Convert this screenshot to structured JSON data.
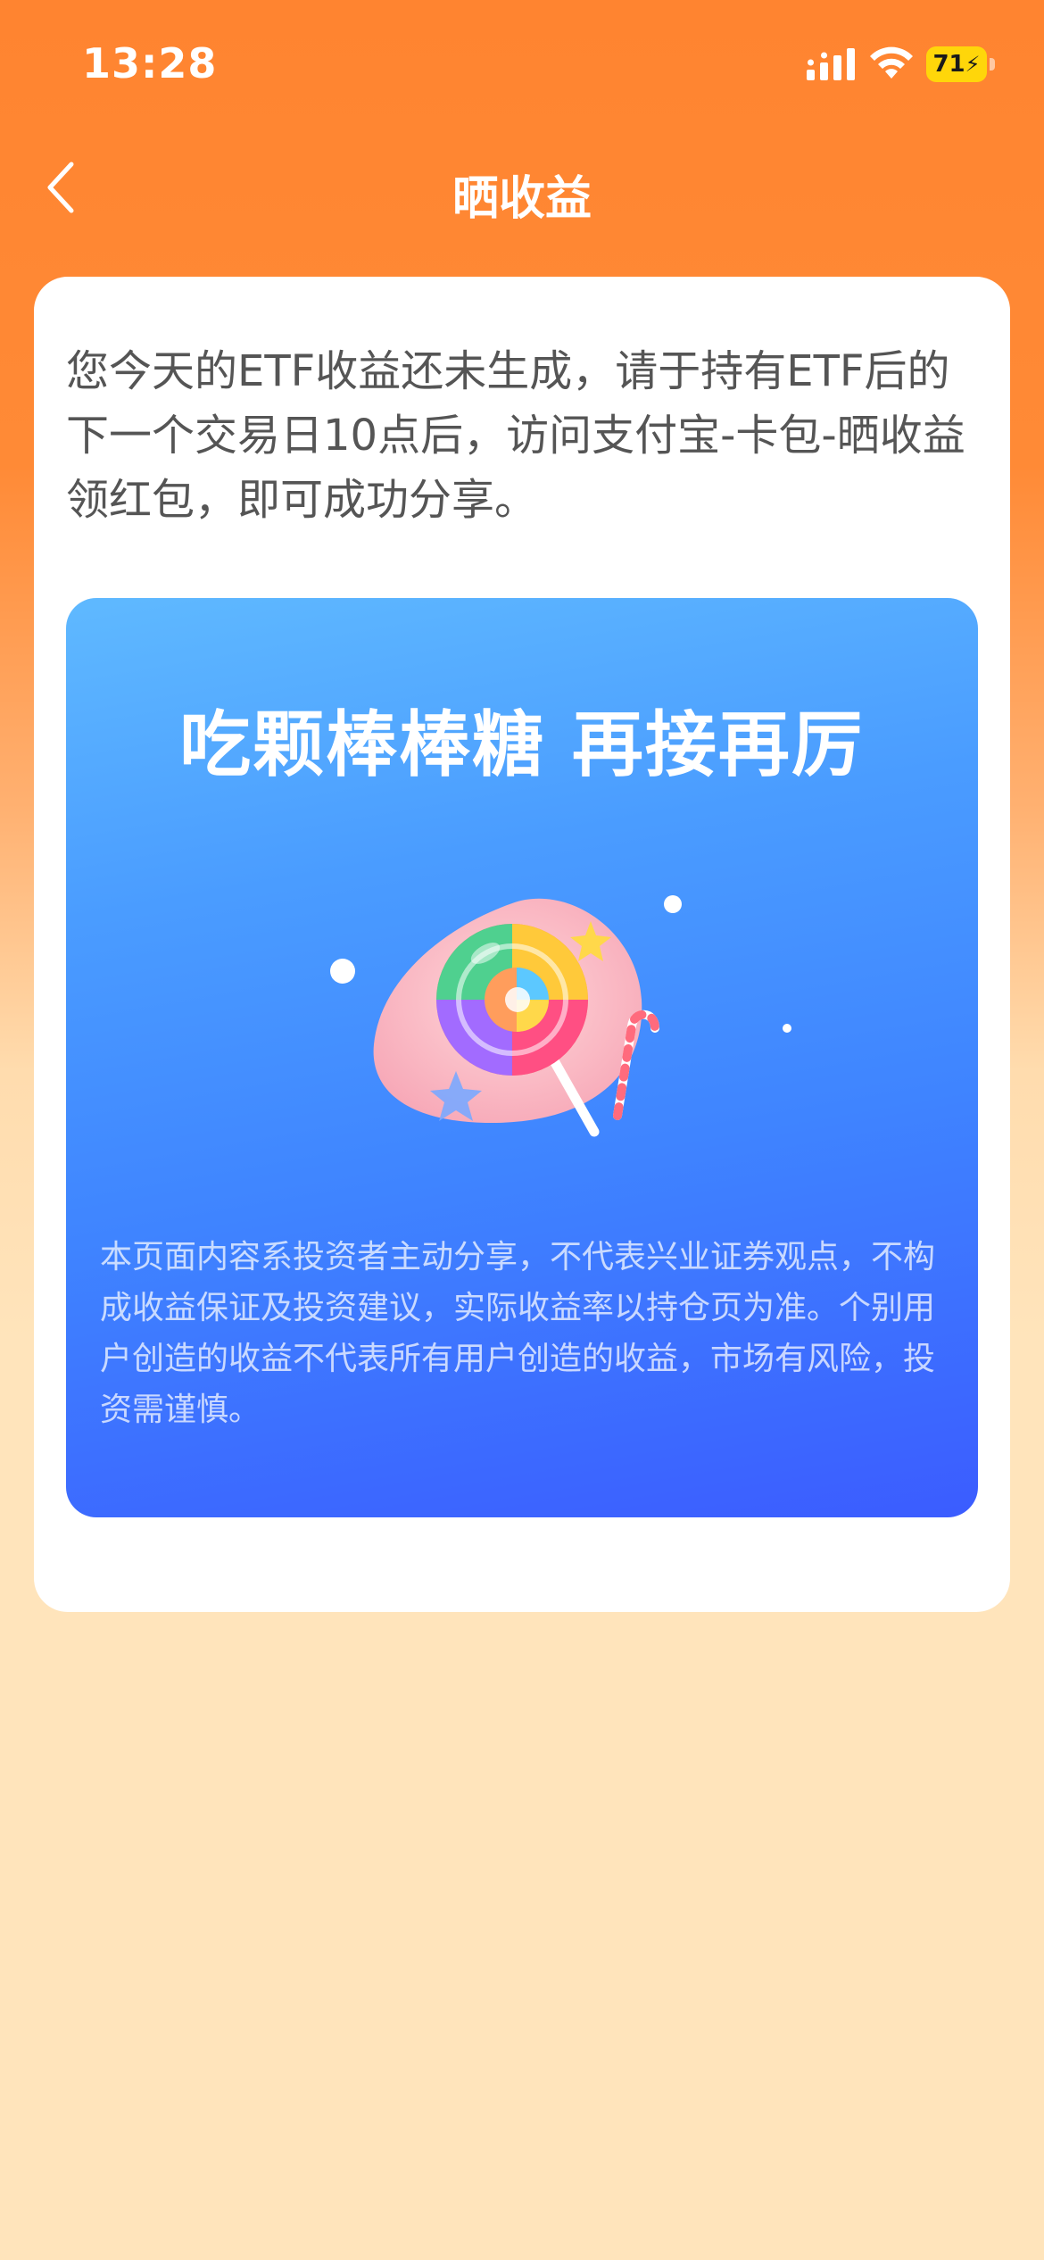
{
  "status_bar": {
    "time": "13:28",
    "battery": "71"
  },
  "nav": {
    "title": "晒收益"
  },
  "notice": {
    "text": "您今天的ETF收益还未生成，请于持有ETF后的下一个交易日10点后，访问支付宝-卡包-晒收益领红包，即可成功分享。"
  },
  "share_card": {
    "headline": "吃颗棒棒糖 再接再厉",
    "disclaimer": "本页面内容系投资者主动分享，不代表兴业证券观点，不构成收益保证及投资建议，实际收益率以持仓页为准。个别用户创造的收益不代表所有用户创造的收益，市场有风险，投资需谨慎。"
  },
  "icons": {
    "back": "chevron-left-icon",
    "signal": "cellular-signal-icon",
    "wifi": "wifi-icon",
    "battery": "battery-charging-icon",
    "illustration": "lollipop-illustration"
  },
  "colors": {
    "header_orange": "#ff8430",
    "page_bottom": "#ffe4bb",
    "card_blue_top": "#5fb9ff",
    "card_blue_bottom": "#3b5cff",
    "battery_yellow": "#ffd60a"
  }
}
